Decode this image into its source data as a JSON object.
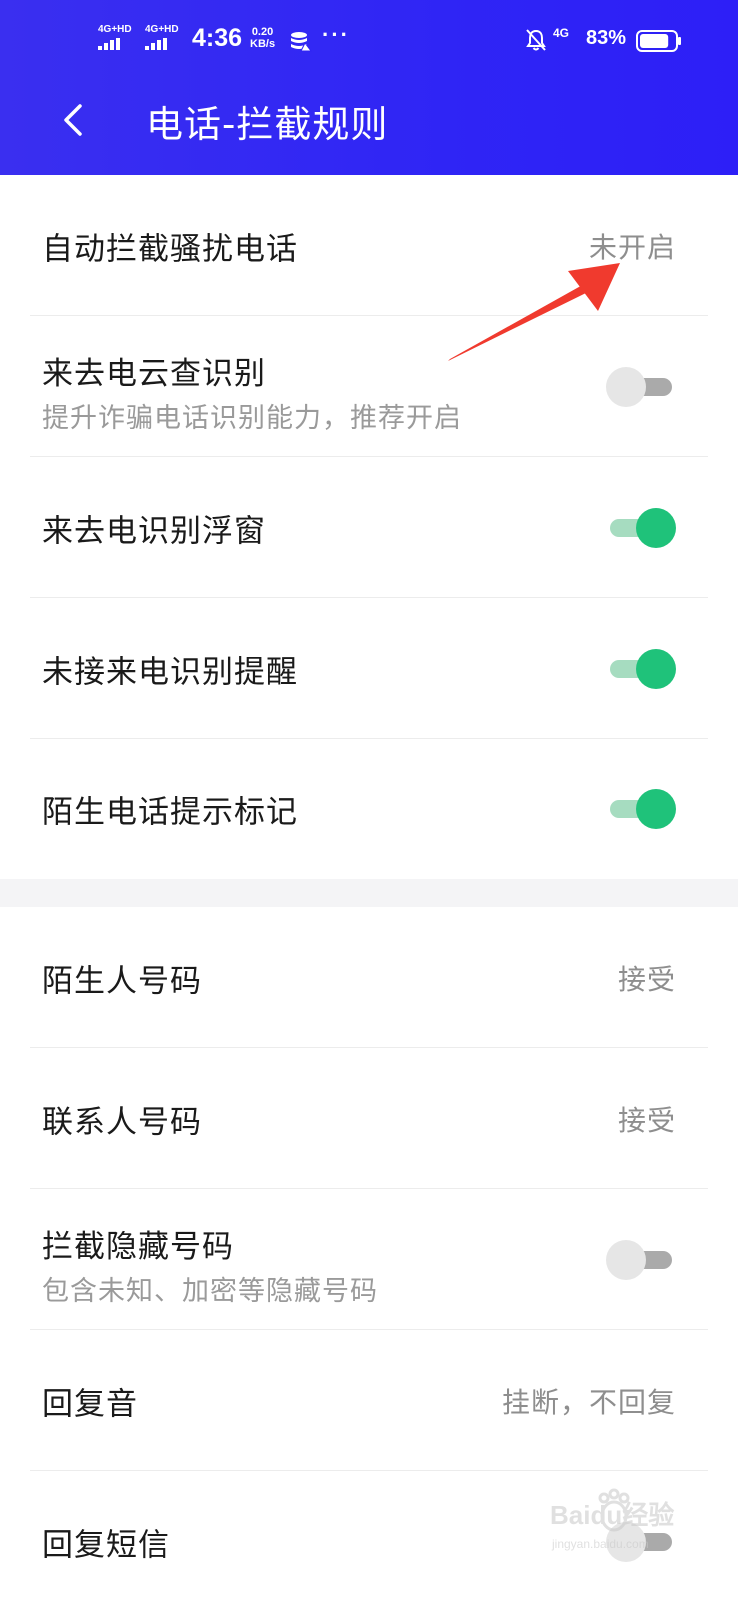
{
  "status_bar": {
    "sim1_label": "4G+HD",
    "sim2_label": "4G+HD",
    "time": "4:36",
    "speed_value": "0.20",
    "speed_unit": "KB/s",
    "more": "···",
    "network": "4G",
    "battery_percent": "83%",
    "battery_level": 0.83
  },
  "header": {
    "back_icon": "chevron-left-icon",
    "title": "电话-拦截规则"
  },
  "section1": [
    {
      "title": "自动拦截骚扰电话",
      "value": "未开启"
    },
    {
      "title": "来去电云查识别",
      "subtitle": "提升诈骗电话识别能力，推荐开启",
      "toggle": "off"
    },
    {
      "title": "来去电识别浮窗",
      "toggle": "on"
    },
    {
      "title": "未接来电识别提醒",
      "toggle": "on"
    },
    {
      "title": "陌生电话提示标记",
      "toggle": "on"
    }
  ],
  "section2": [
    {
      "title": "陌生人号码",
      "value": "接受"
    },
    {
      "title": "联系人号码",
      "value": "接受"
    },
    {
      "title": "拦截隐藏号码",
      "subtitle": "包含未知、加密等隐藏号码",
      "toggle": "off"
    },
    {
      "title": "回复音",
      "value": "挂断，不回复"
    },
    {
      "title": "回复短信",
      "toggle": "off"
    }
  ],
  "watermark": {
    "logo_text": "Baidu经验",
    "url_text": "jingyan.baidu.com"
  },
  "colors": {
    "header_bg": "#2f25f5",
    "toggle_on": "#1fc27a",
    "annotation_arrow": "#f03a2e"
  }
}
